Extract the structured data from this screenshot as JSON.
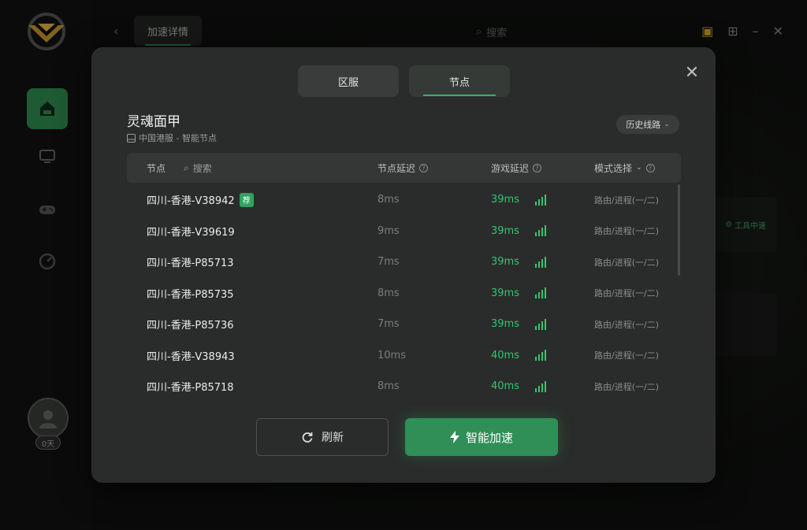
{
  "topbar": {
    "tab_label": "加速详情",
    "search_placeholder": "搜索"
  },
  "bg": {
    "side_card_label": "工具中速"
  },
  "avatar": {
    "badge": "0天"
  },
  "modal": {
    "tabs": [
      {
        "label": "区服",
        "active": false
      },
      {
        "label": "节点",
        "active": true
      }
    ],
    "game_title": "灵魂面甲",
    "game_sub": "中国港服 - 智能节点",
    "history_label": "历史线路",
    "table": {
      "headers": {
        "node": "节点",
        "search": "搜索",
        "node_latency": "节点延迟",
        "game_latency": "游戏延迟",
        "mode": "模式选择"
      },
      "rows": [
        {
          "name": "四川-香港-V38942",
          "badge": "荐",
          "node_latency": "8ms",
          "game_latency": "39ms",
          "mode": "路由/进程(一/二)"
        },
        {
          "name": "四川-香港-V39619",
          "badge": "",
          "node_latency": "9ms",
          "game_latency": "39ms",
          "mode": "路由/进程(一/二)"
        },
        {
          "name": "四川-香港-P85713",
          "badge": "",
          "node_latency": "7ms",
          "game_latency": "39ms",
          "mode": "路由/进程(一/二)"
        },
        {
          "name": "四川-香港-P85735",
          "badge": "",
          "node_latency": "8ms",
          "game_latency": "39ms",
          "mode": "路由/进程(一/二)"
        },
        {
          "name": "四川-香港-P85736",
          "badge": "",
          "node_latency": "7ms",
          "game_latency": "39ms",
          "mode": "路由/进程(一/二)"
        },
        {
          "name": "四川-香港-V38943",
          "badge": "",
          "node_latency": "10ms",
          "game_latency": "40ms",
          "mode": "路由/进程(一/二)"
        },
        {
          "name": "四川-香港-P85718",
          "badge": "",
          "node_latency": "8ms",
          "game_latency": "40ms",
          "mode": "路由/进程(一/二)"
        }
      ]
    },
    "refresh_label": "刷新",
    "smart_label": "智能加速"
  },
  "colors": {
    "accent": "#2f8f56",
    "latency_good": "#35c474"
  }
}
